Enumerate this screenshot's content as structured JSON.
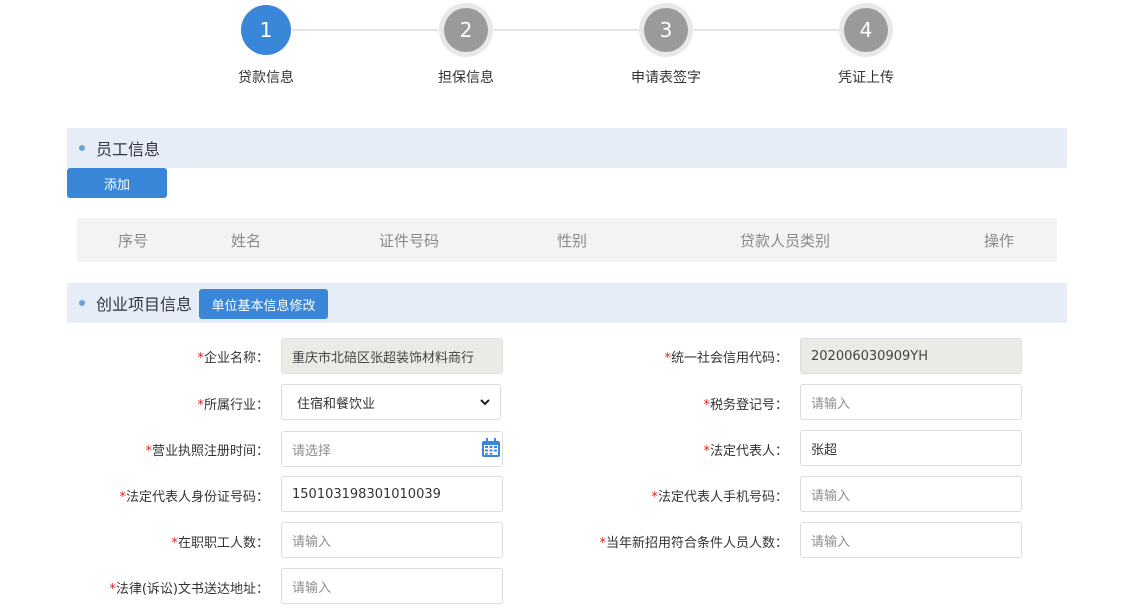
{
  "steps": [
    {
      "number": "1",
      "label": "贷款信息",
      "active": true
    },
    {
      "number": "2",
      "label": "担保信息",
      "active": false
    },
    {
      "number": "3",
      "label": "申请表签字",
      "active": false
    },
    {
      "number": "4",
      "label": "凭证上传",
      "active": false
    }
  ],
  "employee_section": {
    "title": "员工信息",
    "add_button": "添加",
    "columns": [
      "序号",
      "姓名",
      "证件号码",
      "性别",
      "贷款人员类别",
      "操作"
    ]
  },
  "project_section": {
    "title": "创业项目信息",
    "modify_button": "单位基本信息修改"
  },
  "form": {
    "required_mark": "*",
    "company_name": {
      "label": "企业名称：",
      "value": "重庆市北碚区张超装饰材料商行"
    },
    "credit_code": {
      "label": "统一社会信用代码：",
      "value": "202006030909YH"
    },
    "industry": {
      "label": "所属行业：",
      "value": "住宿和餐饮业",
      "icon": "chevron-down-icon"
    },
    "tax_no": {
      "label": "税务登记号：",
      "placeholder": "请输入"
    },
    "license_date": {
      "label": "营业执照注册时间：",
      "placeholder": "请选择",
      "icon": "calendar-icon"
    },
    "legal_rep": {
      "label": "法定代表人：",
      "value": "张超"
    },
    "legal_rep_id": {
      "label": "法定代表人身份证号码：",
      "value": "150103198301010039"
    },
    "legal_rep_phone": {
      "label": "法定代表人手机号码：",
      "placeholder": "请输入"
    },
    "staff_count": {
      "label": "在职职工人数：",
      "placeholder": "请输入"
    },
    "new_hires": {
      "label": "当年新招用符合条件人员人数：",
      "placeholder": "请输入"
    },
    "legal_address": {
      "label": "法律(诉讼)文书送达地址：",
      "placeholder": "请输入"
    }
  },
  "colors": {
    "accent": "#3a86d8",
    "inactive_step": "#9a9a9a",
    "section_bg": "#e6edf7",
    "required": "#e02020"
  }
}
